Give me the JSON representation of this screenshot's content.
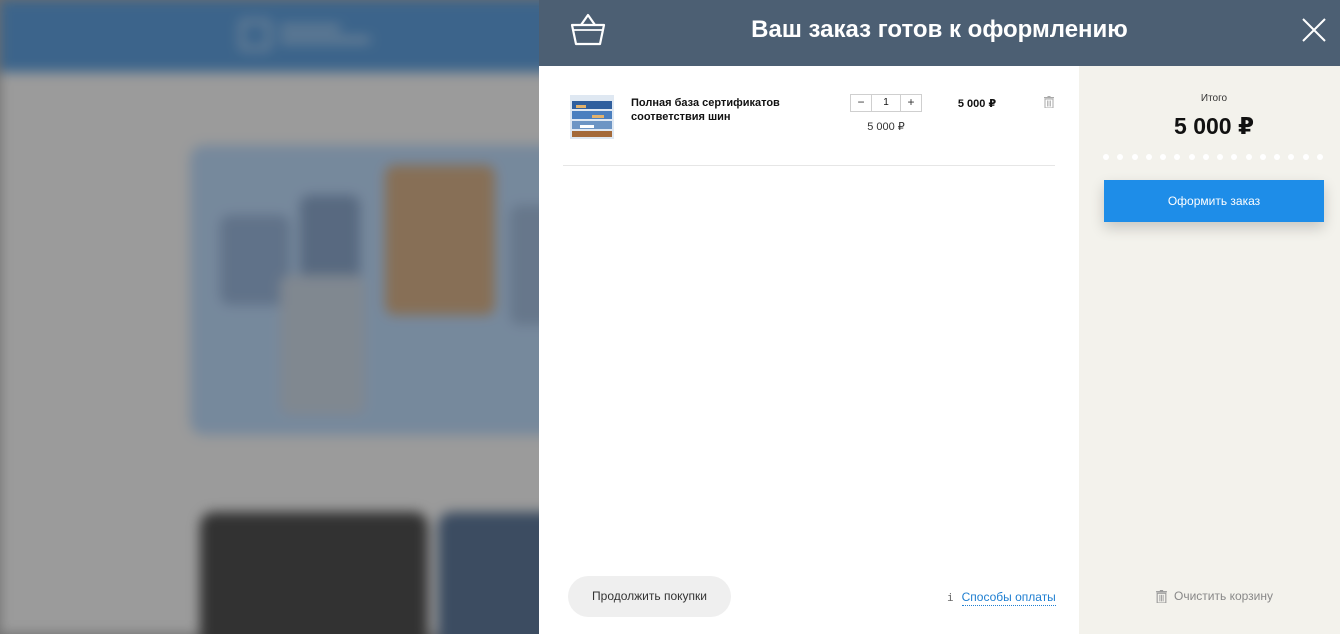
{
  "modal": {
    "title": "Ваш заказ готов к оформлению",
    "icons": {
      "basket": "basket-icon",
      "close": "close-icon"
    }
  },
  "cart": {
    "items": [
      {
        "name": "Полная база сертификатов соответствия шин",
        "quantity": "1",
        "decrement_label": "−",
        "increment_label": "+",
        "unit_price": "5 000 ₽",
        "row_price": "5 000 ₽",
        "icon": "trash-icon"
      }
    ],
    "continue_label": "Продолжить покупки",
    "payment_info_icon": "i",
    "payment_methods_label": "Способы оплаты"
  },
  "summary": {
    "total_label": "Итого",
    "total_value": "5 000 ₽",
    "checkout_label": "Оформить заказ",
    "clear_label": "Очистить корзину"
  },
  "colors": {
    "header_bg": "#4c5f73",
    "accent": "#1e8de8",
    "summary_bg": "#f3f2ec",
    "link": "#1f7fd1"
  }
}
